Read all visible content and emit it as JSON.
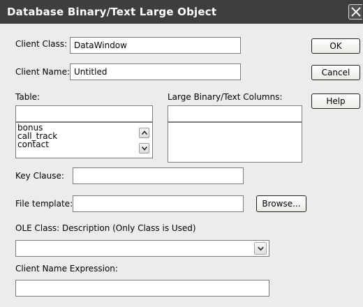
{
  "window": {
    "title": "Database Binary/Text Large Object"
  },
  "icons": {
    "close": "close-icon",
    "scroll_up": "chevron-up-icon",
    "scroll_down": "chevron-down-icon",
    "combo": "chevron-down-icon"
  },
  "fields": {
    "client_class": {
      "label": "Client Class:",
      "value": "DataWindow"
    },
    "client_name": {
      "label": "Client Name:",
      "value": "Untitled"
    },
    "table": {
      "label": "Table:",
      "value": "",
      "items": [
        "bonus",
        "call_track",
        "contact"
      ]
    },
    "large_columns": {
      "label": "Large Binary/Text Columns:",
      "value": ""
    },
    "key_clause": {
      "label": "Key Clause:",
      "value": ""
    },
    "file_template": {
      "label": "File template:",
      "value": ""
    },
    "ole_class": {
      "label": "OLE Class: Description (Only Class is Used)",
      "value": ""
    },
    "client_name_expression": {
      "label": "Client Name Expression:",
      "value": ""
    }
  },
  "buttons": {
    "ok": "OK",
    "cancel": "Cancel",
    "help": "Help",
    "browse": "Browse..."
  }
}
